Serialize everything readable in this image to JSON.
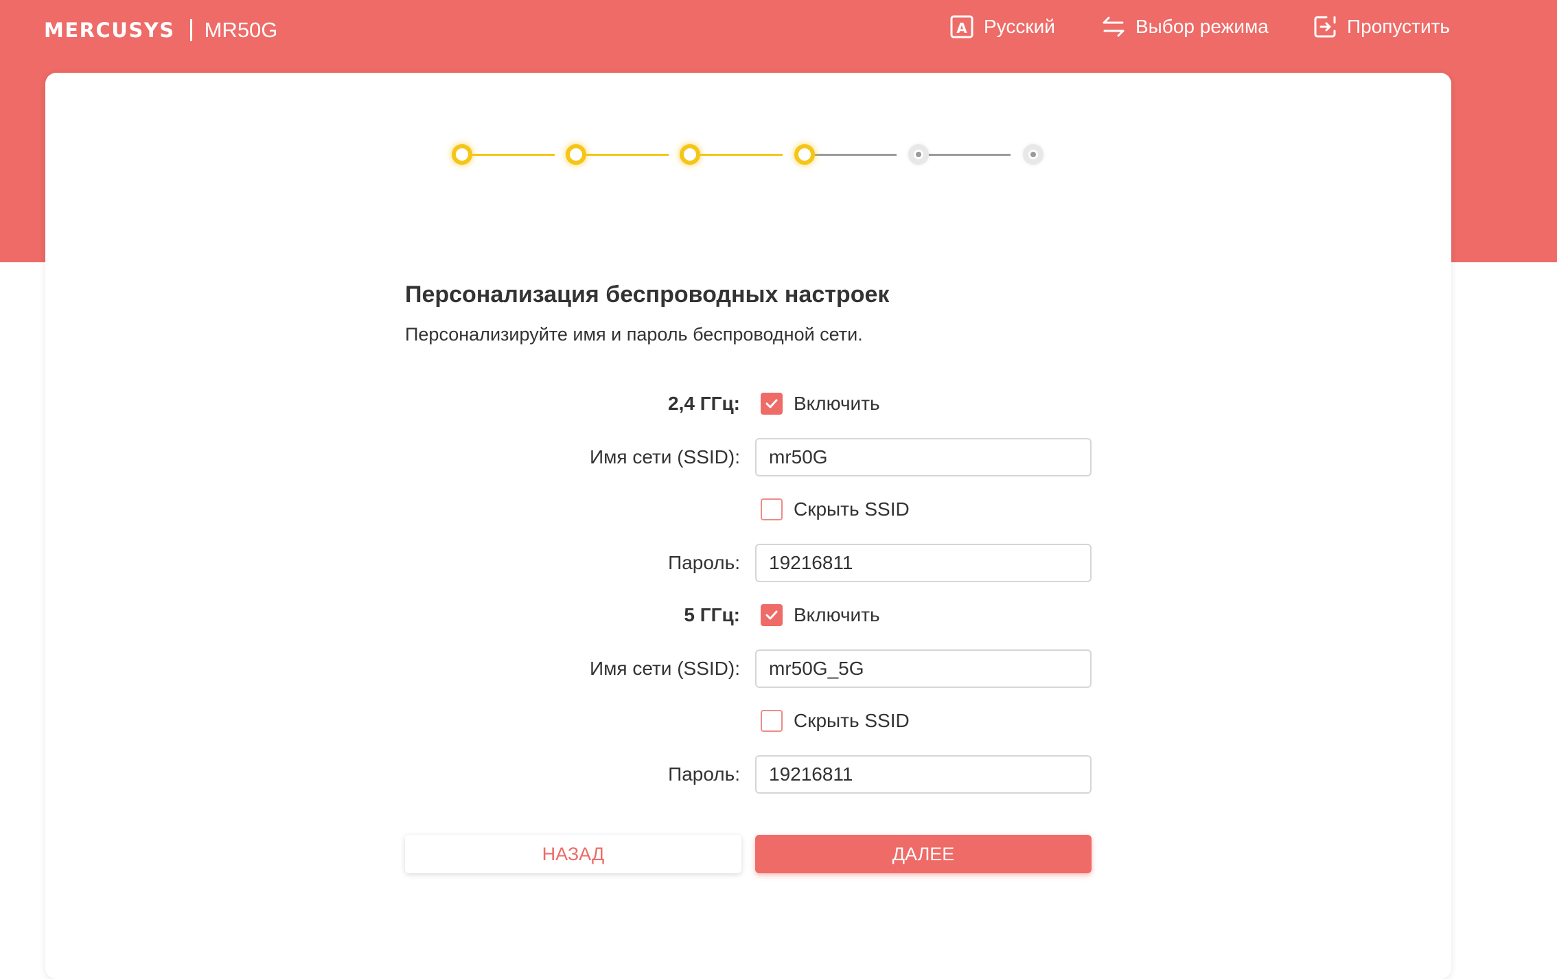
{
  "header": {
    "brand": "MERCUSYS",
    "model": "MR50G",
    "language_label": "Русский",
    "mode_label": "Выбор режима",
    "skip_label": "Пропустить"
  },
  "stepper": {
    "total_steps": 6,
    "completed_steps": 4,
    "active_color": "#f5c518",
    "inactive_color": "#9a9a9a"
  },
  "page": {
    "title": "Персонализация беспроводных настроек",
    "subtitle": "Персонализируйте имя и пароль беспроводной сети."
  },
  "band_24": {
    "band_label": "2,4 ГГц:",
    "enable_label": "Включить",
    "enabled": true,
    "ssid_label": "Имя сети (SSID):",
    "ssid_value": "mr50G",
    "hide_label": "Скрыть SSID",
    "hidden": false,
    "password_label": "Пароль:",
    "password_value": "19216811"
  },
  "band_5": {
    "band_label": "5 ГГц:",
    "enable_label": "Включить",
    "enabled": true,
    "ssid_label": "Имя сети (SSID):",
    "ssid_value": "mr50G_5G",
    "hide_label": "Скрыть SSID",
    "hidden": false,
    "password_label": "Пароль:",
    "password_value": "19216811"
  },
  "buttons": {
    "back_label": "НАЗАД",
    "next_label": "ДАЛЕЕ"
  },
  "colors": {
    "brand": "#ee6b67",
    "step_active": "#f5c518"
  }
}
